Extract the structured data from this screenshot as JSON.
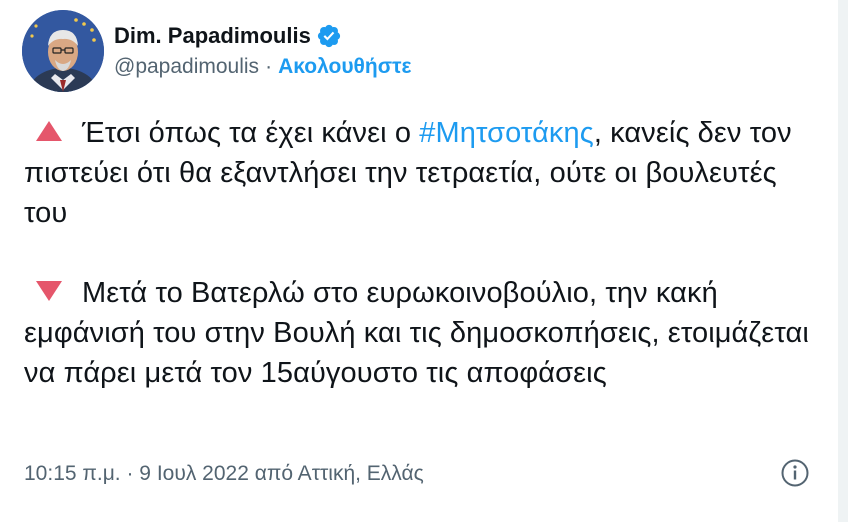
{
  "tweet": {
    "author": {
      "display_name": "Dim. Papadimoulis",
      "handle": "@papadimoulis",
      "separator": "·",
      "follow_label": "Ακολουθήστε",
      "verified": true
    },
    "paragraphs": [
      {
        "marker": "triangle-up",
        "before": "Έτσι όπως τα έχει κάνει ο ",
        "hashtag": "#Μητσοτάκης",
        "after": ", κανείς δεν τον πιστεύει ότι θα εξαντλήσει την τετραετία, ούτε οι βουλευτές του"
      },
      {
        "marker": "triangle-down",
        "text": "Μετά το Βατερλώ στο ευρωκοινοβούλιο, την κακή εμφάνισή του στην Βουλή και τις δημοσκοπήσεις, ετοιμάζεται να πάρει μετά τον 15αύγουστο τις αποφάσεις"
      }
    ],
    "timestamp": "10:15 π.μ. · 9 Ιουλ 2022 από Αττική, Ελλάς"
  },
  "colors": {
    "accent": "#1d9bf0",
    "marker": "#e5566b",
    "muted": "#536471",
    "text": "#0f1419"
  },
  "icons": {
    "verified": "verified-badge-icon",
    "info": "info-icon"
  }
}
